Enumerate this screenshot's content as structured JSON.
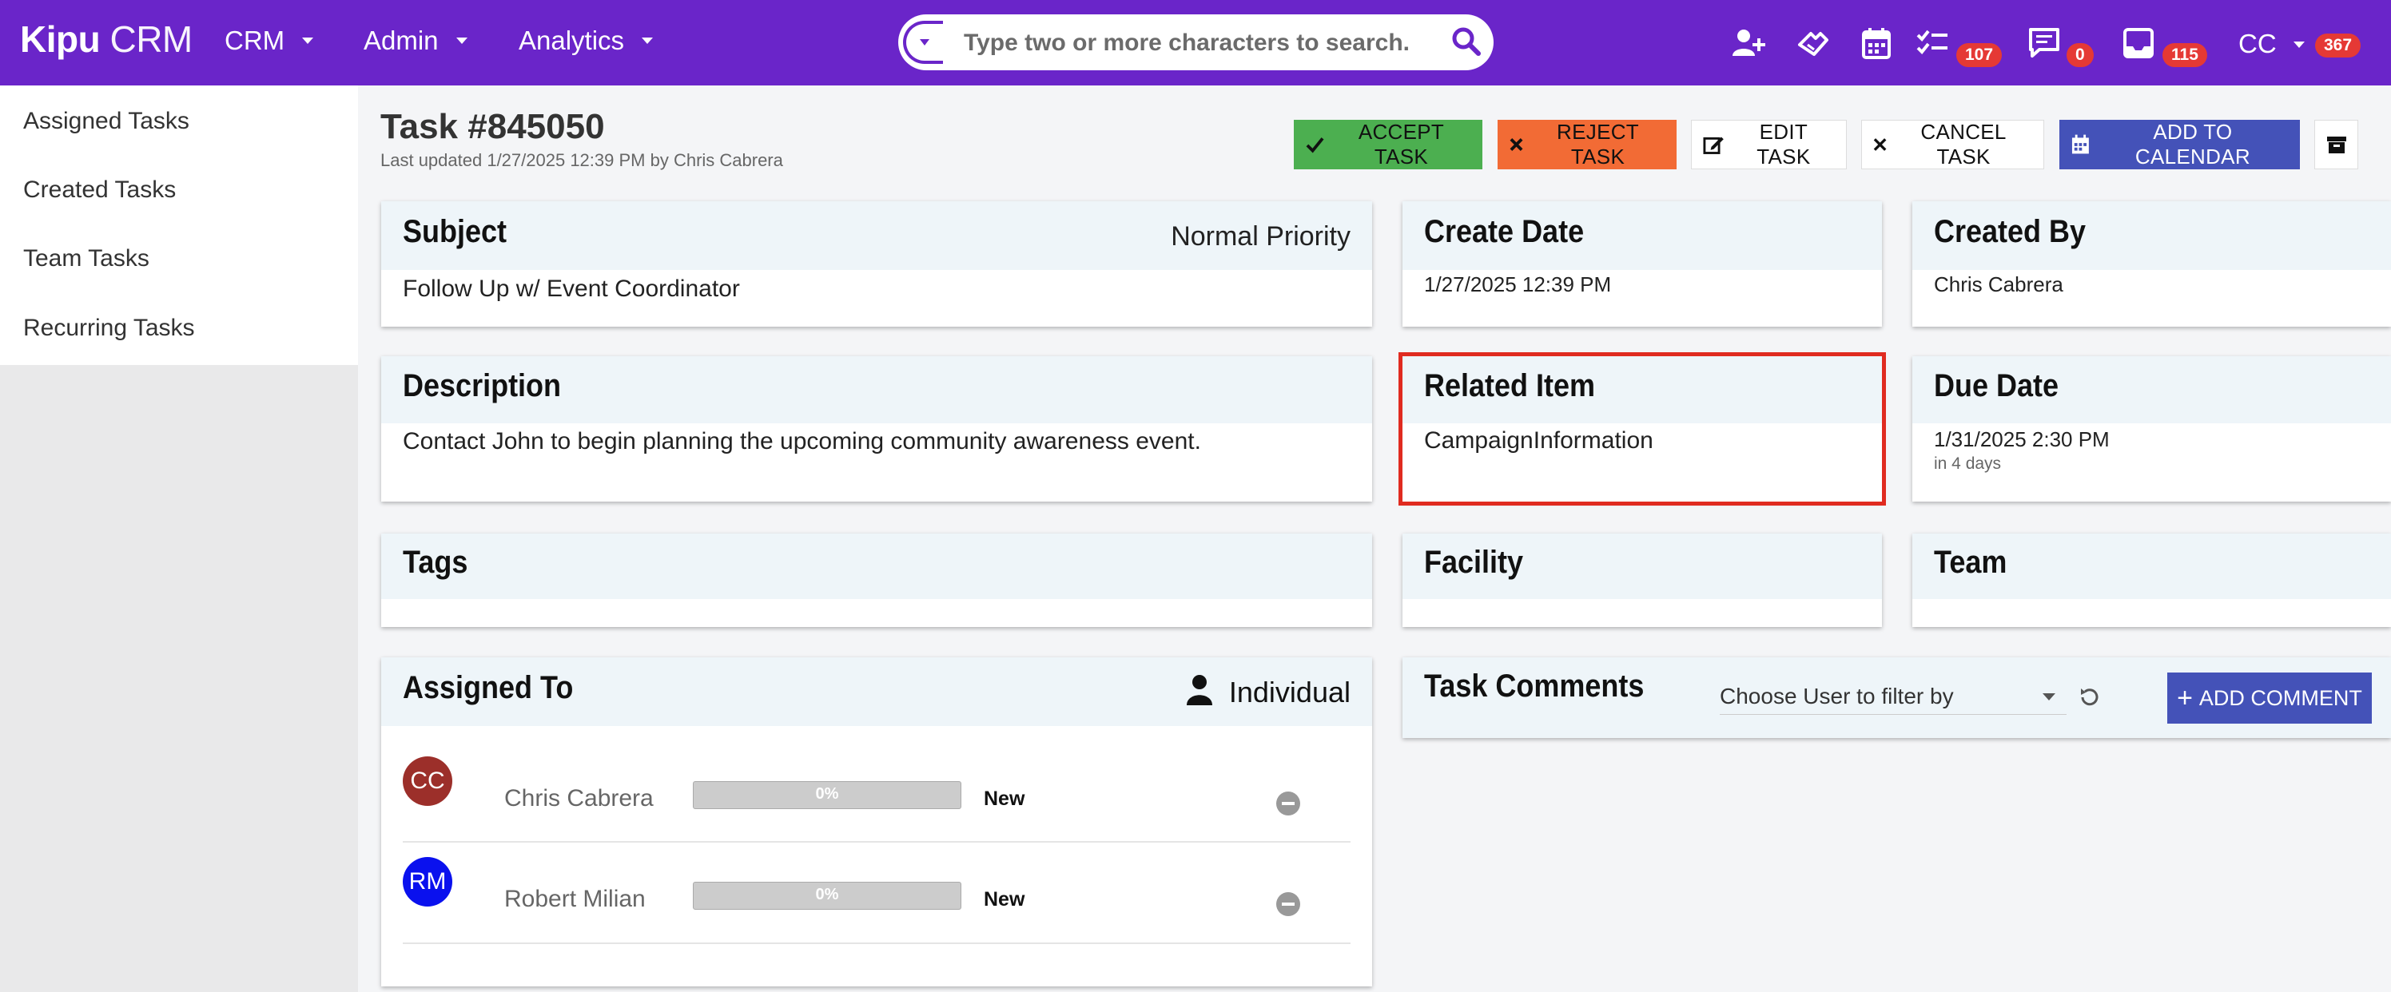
{
  "app": {
    "logo_bold": "Kipu",
    "logo_rest": " CRM",
    "menus": [
      "CRM",
      "Admin",
      "Analytics"
    ]
  },
  "search": {
    "placeholder": "Type two or more characters to search..."
  },
  "header_icons": {
    "tasks_badge": "107",
    "messages_badge": "0",
    "inbox_badge": "115",
    "user_initials": "CC",
    "user_badge": "367"
  },
  "sidebar": {
    "items": [
      "Assigned Tasks",
      "Created Tasks",
      "Team Tasks",
      "Recurring Tasks"
    ]
  },
  "task": {
    "title": "Task #845050",
    "updated": "Last updated 1/27/2025 12:39 PM by Chris Cabrera"
  },
  "actions": {
    "accept": "ACCEPT TASK",
    "reject": "REJECT TASK",
    "edit": "EDIT TASK",
    "cancel": "CANCEL TASK",
    "calendar": "ADD TO CALENDAR"
  },
  "cards": {
    "subject": {
      "title": "Subject",
      "priority": "Normal Priority",
      "value": "Follow Up w/ Event Coordinator"
    },
    "create_date": {
      "title": "Create Date",
      "value": "1/27/2025 12:39 PM"
    },
    "created_by": {
      "title": "Created By",
      "value": "Chris Cabrera"
    },
    "description": {
      "title": "Description",
      "value": "Contact John to begin planning the upcoming community awareness event."
    },
    "related_item": {
      "title": "Related Item",
      "value": "CampaignInformation"
    },
    "due_date": {
      "title": "Due Date",
      "value": "1/31/2025 2:30 PM",
      "relative": "in 4 days"
    },
    "tags": {
      "title": "Tags"
    },
    "facility": {
      "title": "Facility"
    },
    "team": {
      "title": "Team"
    },
    "assigned_to": {
      "title": "Assigned To",
      "mode": "Individual"
    },
    "task_comments": {
      "title": "Task Comments",
      "filter_placeholder": "Choose User to filter by",
      "add_label": "ADD COMMENT"
    }
  },
  "assignees": [
    {
      "initials": "CC",
      "name": "Chris Cabrera",
      "progress_label": "0%",
      "progress": 0,
      "status": "New",
      "color": "#9c2f2a"
    },
    {
      "initials": "RM",
      "name": "Robert Milian",
      "progress_label": "0%",
      "progress": 0,
      "status": "New",
      "color": "#0a11ee"
    }
  ],
  "colors": {
    "brand": "#6a25c9",
    "accept": "#4caf50",
    "reject": "#f26b35",
    "primary": "#4452b8",
    "badge": "#e53935"
  }
}
